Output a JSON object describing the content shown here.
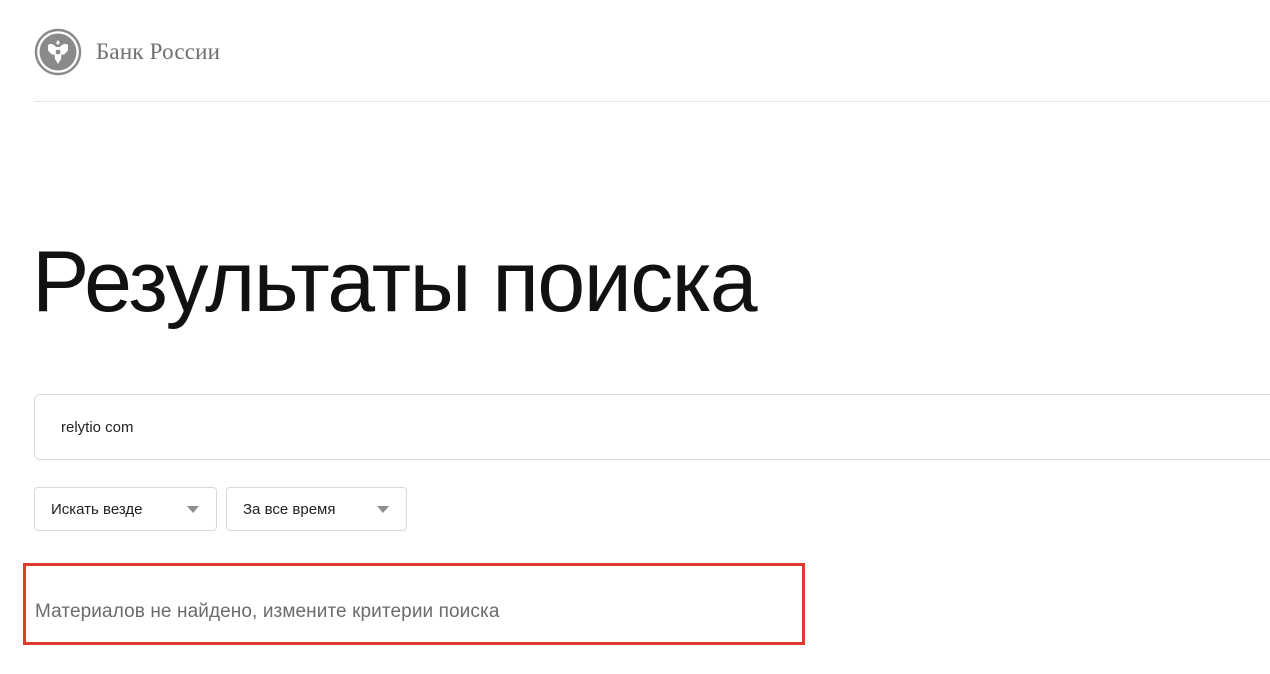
{
  "header": {
    "logo_text": "Банк России",
    "logo_icon": "double-headed-eagle-emblem"
  },
  "main": {
    "title": "Результаты поиска",
    "search": {
      "value": "relytio com"
    },
    "filters": [
      {
        "label": "Искать везде",
        "icon": "caret-down-icon"
      },
      {
        "label": "За все время",
        "icon": "caret-down-icon"
      }
    ],
    "empty_message": "Материалов не найдено, измените критерии поиска"
  },
  "colors": {
    "highlight_border": "#e03a2f",
    "logo_fill": "#8a8a8a",
    "muted_text": "#6b6b6b"
  }
}
